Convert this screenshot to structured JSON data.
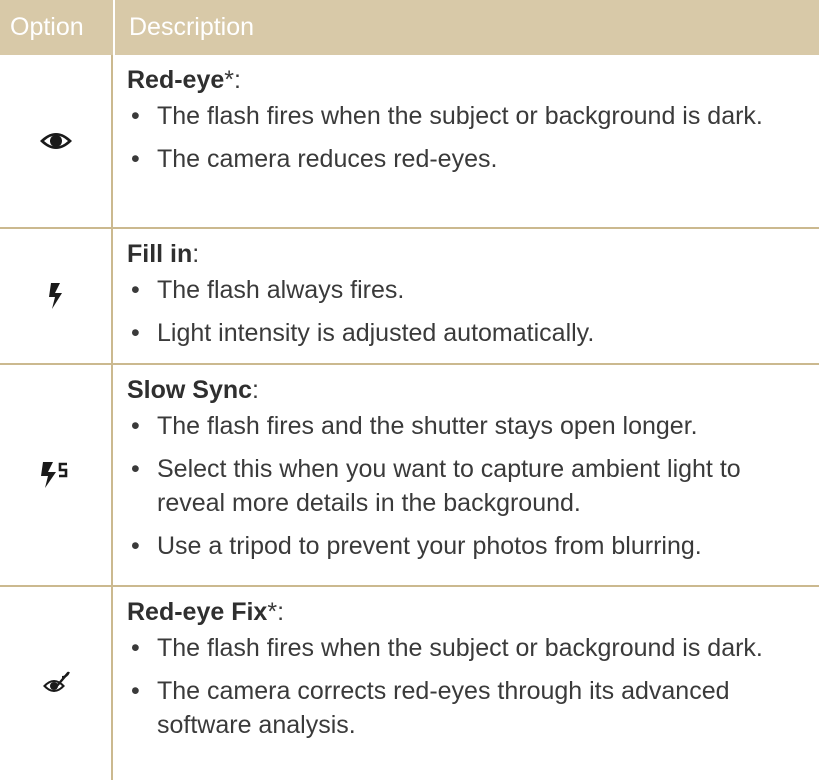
{
  "header": {
    "option": "Option",
    "description": "Description"
  },
  "rows": [
    {
      "icon": "red-eye-icon",
      "title_bold": "Red-eye",
      "title_suffix": "*:",
      "bullets": [
        "The flash fires when the subject or background is dark.",
        "The camera reduces red-eyes."
      ]
    },
    {
      "icon": "fill-in-flash-icon",
      "title_bold": "Fill in",
      "title_suffix": ":",
      "bullets": [
        "The flash always fires.",
        "Light intensity is adjusted automatically."
      ]
    },
    {
      "icon": "slow-sync-flash-icon",
      "title_bold": "Slow Sync",
      "title_suffix": ":",
      "bullets": [
        "The flash fires and the shutter stays open longer.",
        "Select this when you want to capture ambient light to reveal more details in the background.",
        "Use a tripod to prevent your photos from blurring."
      ]
    },
    {
      "icon": "red-eye-fix-icon",
      "title_bold": "Red-eye Fix",
      "title_suffix": "*:",
      "bullets": [
        "The flash fires when the subject or background is dark.",
        "The camera corrects red-eyes through its advanced software analysis."
      ]
    }
  ],
  "colors": {
    "header_bg": "#d8c9a8",
    "rule": "#cbb98f",
    "text": "#3a3a3a"
  }
}
